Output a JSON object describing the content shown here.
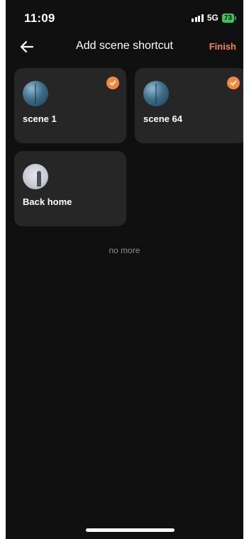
{
  "status_bar": {
    "time": "11:09",
    "network": "5G",
    "battery": "73"
  },
  "nav": {
    "title": "Add scene shortcut",
    "finish_label": "Finish",
    "back_icon": "back-arrow-icon"
  },
  "scenes": [
    {
      "label": "scene 1",
      "selected": true,
      "icon": "sky-thumbnail"
    },
    {
      "label": "scene 64",
      "selected": true,
      "icon": "sky-thumbnail"
    },
    {
      "label": "Back home",
      "selected": false,
      "icon": "home-thumbnail"
    }
  ],
  "list_footer": "no more",
  "colors": {
    "accent": "#f2883a",
    "background": "#0f0f0f",
    "card": "#262626",
    "battery": "#34c759"
  }
}
